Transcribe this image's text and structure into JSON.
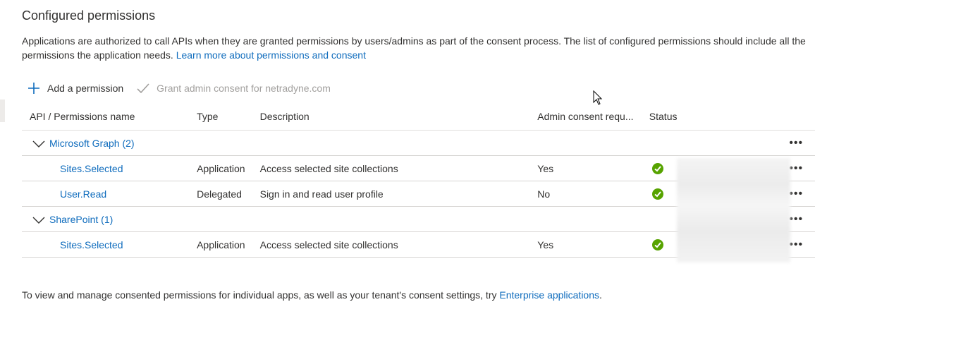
{
  "section": {
    "title": "Configured permissions",
    "description": "Applications are authorized to call APIs when they are granted permissions by users/admins as part of the consent process. The list of configured permissions should include all the permissions the application needs.",
    "learn_more_link": "Learn more about permissions and consent"
  },
  "toolbar": {
    "add_label": "Add a permission",
    "grant_label": "Grant admin consent for netradyne.com"
  },
  "table": {
    "headers": {
      "name": "API / Permissions name",
      "type": "Type",
      "description": "Description",
      "admin": "Admin consent requ...",
      "status": "Status"
    },
    "groups": [
      {
        "label": "Microsoft Graph (2)",
        "rows": [
          {
            "name": "Sites.Selected",
            "type": "Application",
            "description": "Access selected site collections",
            "admin": "Yes"
          },
          {
            "name": "User.Read",
            "type": "Delegated",
            "description": "Sign in and read user profile",
            "admin": "No"
          }
        ]
      },
      {
        "label": "SharePoint (1)",
        "rows": [
          {
            "name": "Sites.Selected",
            "type": "Application",
            "description": "Access selected site collections",
            "admin": "Yes"
          }
        ]
      }
    ],
    "more_glyph": "•••"
  },
  "footer": {
    "text": "To view and manage consented permissions for individual apps, as well as your tenant's consent settings, try",
    "link": "Enterprise applications",
    "end": "."
  },
  "colors": {
    "link": "#0f6cbd",
    "status_ok": "#57a300"
  },
  "icons": [
    "plus-icon",
    "checkmark-icon",
    "chevron-down-icon",
    "status-ok-icon",
    "more-options-icon",
    "mouse-cursor-icon"
  ]
}
